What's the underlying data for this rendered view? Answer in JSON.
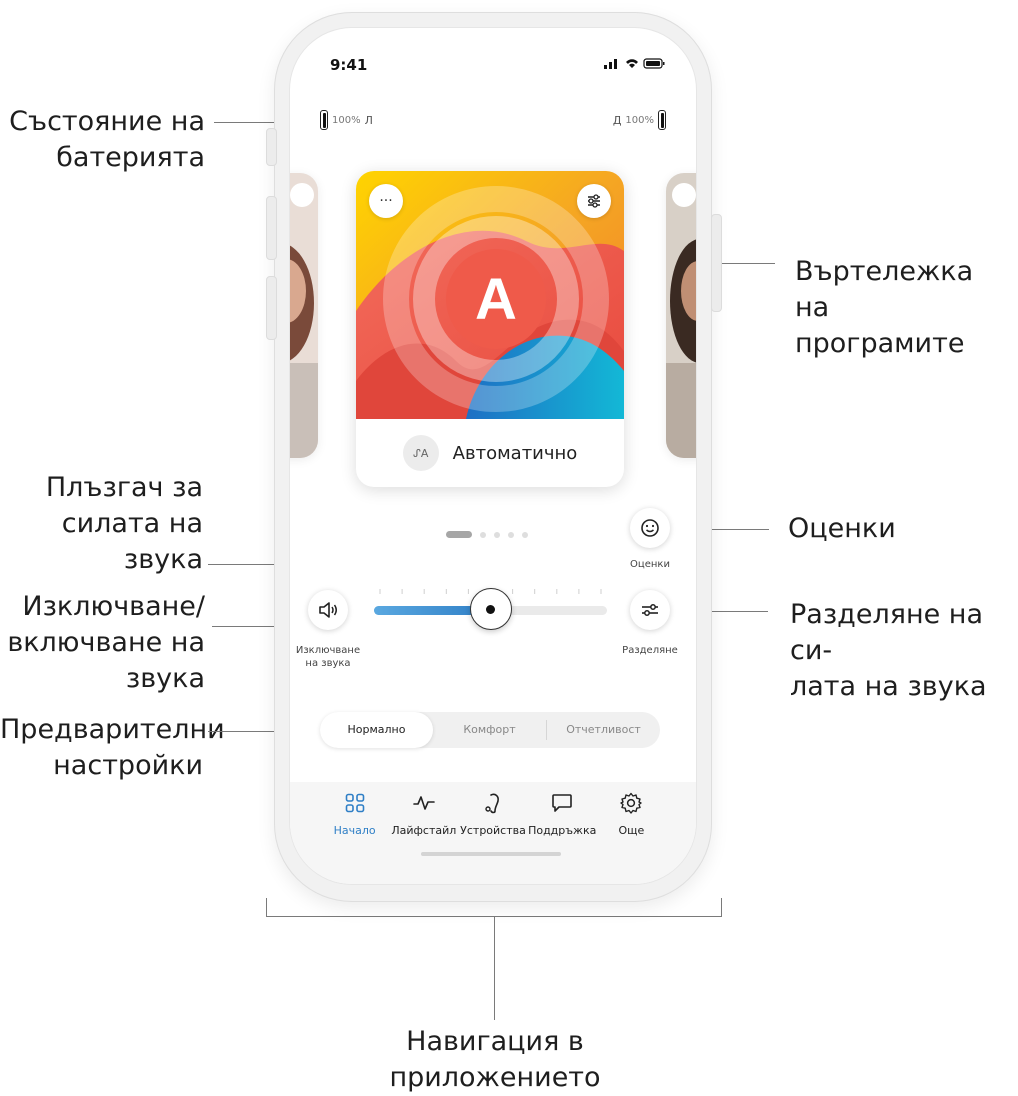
{
  "callouts": {
    "battery": "Състояние на\nбатерията",
    "carousel": "Въртележка на\nпрограмите",
    "volume_slider": "Плъзгач за\nсилата на\nзвука",
    "ratings": "Оценки",
    "mute": "Изключване/\nвключване на\nзвука",
    "split": "Разделяне на си-\nлата на звука",
    "presets": "Предварителни\nнастройки",
    "navigation": "Навигация в приложението"
  },
  "status_bar": {
    "time": "9:41",
    "icons": "▂▄▆ ᯤ ▬"
  },
  "battery": {
    "left": {
      "percent": "100%",
      "side": "Л"
    },
    "right": {
      "percent": "100%",
      "side": "Д"
    }
  },
  "program": {
    "badge": "A",
    "name": "Автоматично",
    "more_glyph": "···",
    "device_glyph": "ᔑA"
  },
  "carousel": {
    "index": 0,
    "count": 5
  },
  "volume": {
    "level": 0.5
  },
  "controls": {
    "mute_label": "Изключване\nна звука",
    "ratings_label": "Оценки",
    "split_label": "Разделяне"
  },
  "presets": [
    "Нормално",
    "Комфорт",
    "Отчетливост"
  ],
  "active_preset": 0,
  "nav": [
    {
      "label": "Начало",
      "icon": "grid-icon",
      "active": true
    },
    {
      "label": "Лайфстайл",
      "icon": "pulse-icon",
      "active": false
    },
    {
      "label": "Устройства",
      "icon": "hearing-aid-icon",
      "active": false
    },
    {
      "label": "Поддръжка",
      "icon": "chat-icon",
      "active": false
    },
    {
      "label": "Още",
      "icon": "gear-icon",
      "active": false
    }
  ],
  "colors": {
    "accent": "#2F7FC6",
    "slider_start": "#5AA8E0"
  }
}
